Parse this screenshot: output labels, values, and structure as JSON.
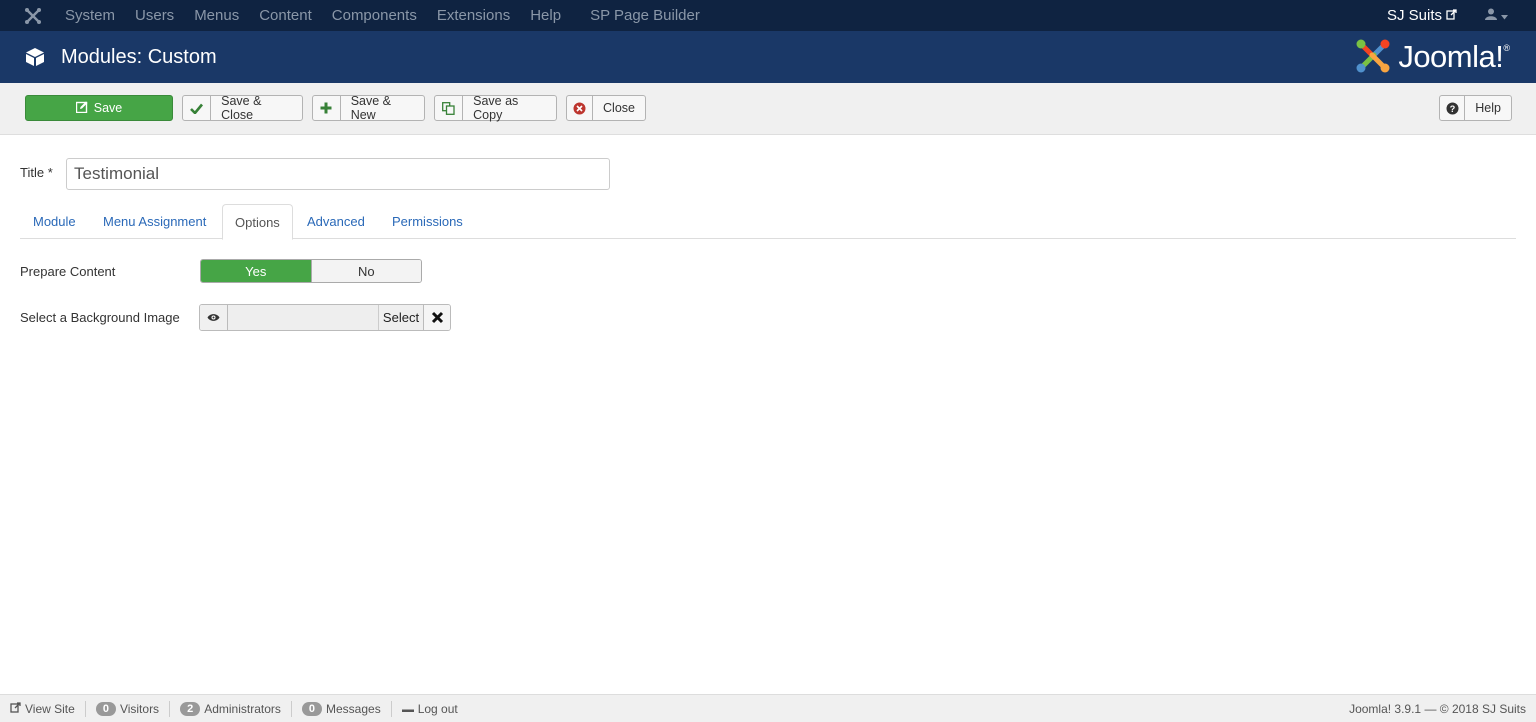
{
  "topnav": {
    "menu": [
      "System",
      "Users",
      "Menus",
      "Content",
      "Components",
      "Extensions",
      "Help",
      "SP Page Builder"
    ],
    "site_name": "SJ Suits"
  },
  "header": {
    "title": "Modules: Custom",
    "logo_text": "Joomla!",
    "logo_reg": "®"
  },
  "toolbar": {
    "save": "Save",
    "save_close": "Save & Close",
    "save_new": "Save & New",
    "save_copy": "Save as Copy",
    "close": "Close",
    "help": "Help"
  },
  "form": {
    "title_label": "Title *",
    "title_value": "Testimonial",
    "tabs": [
      "Module",
      "Menu Assignment",
      "Options",
      "Advanced",
      "Permissions"
    ],
    "active_tab": "Options",
    "prepare_content_label": "Prepare Content",
    "yes": "Yes",
    "no": "No",
    "bg_image_label": "Select a Background Image",
    "select_label": "Select"
  },
  "status": {
    "view_site": "View Site",
    "visitors_count": "0",
    "visitors": "Visitors",
    "admins_count": "2",
    "admins": "Administrators",
    "messages_count": "0",
    "messages": "Messages",
    "logout": "Log out",
    "version": "Joomla! 3.9.1  —  © 2018 SJ Suits"
  },
  "colors": {
    "topnav_bg": "#0f2341",
    "header_bg": "#1a3867",
    "success": "#46a546",
    "link": "#2a69b8"
  }
}
